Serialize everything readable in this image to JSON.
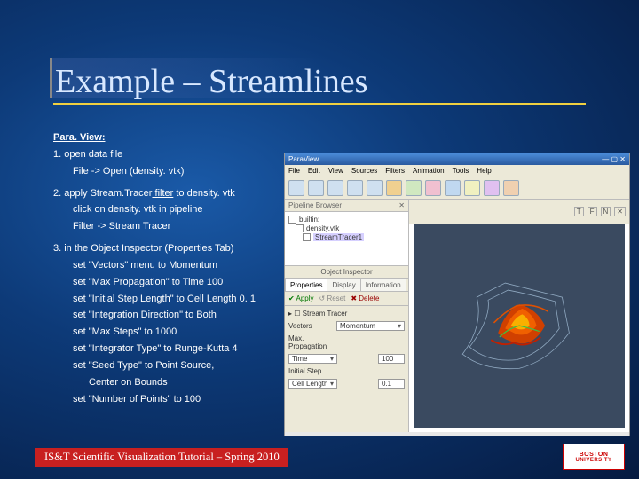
{
  "slide": {
    "title": "Example – Streamlines"
  },
  "instructions": {
    "heading": "Para. View:",
    "step1": "1. open data file",
    "step1a": "File -> Open (density. vtk)",
    "step2_pre": "2. apply Stream.Tracer",
    "step2_mid": " filter",
    "step2_post": " to density. vtk",
    "step2a": "click on density. vtk in pipeline",
    "step2b": "Filter -> Stream Tracer",
    "step3": "3. in the Object Inspector (Properties Tab)",
    "step3a": "set \"Vectors\" menu to Momentum",
    "step3b": "set \"Max Propagation\" to Time 100",
    "step3c": "set \"Initial Step Length\" to Cell Length 0. 1",
    "step3d": "set \"Integration Direction\" to Both",
    "step3e": "set \"Max Steps\" to 1000",
    "step3f": "set \"Integrator Type\" to Runge-Kutta 4",
    "step3g": "set \"Seed Type\" to Point Source,",
    "step3h": "Center on Bounds",
    "step3i": "set \"Number of Points\" to 100"
  },
  "paraview": {
    "window_title": "ParaView",
    "menu": {
      "file": "File",
      "edit": "Edit",
      "view": "View",
      "sources": "Sources",
      "filters": "Filters",
      "animation": "Animation",
      "tools": "Tools",
      "help": "Help"
    },
    "pipeline": {
      "header": "Pipeline Browser",
      "item0": "builtin:",
      "item1": "density.vtk",
      "item2": "StreamTracer1"
    },
    "inspector": {
      "header": "Object Inspector",
      "tab_prop": "Properties",
      "tab_disp": "Display",
      "tab_info": "Information",
      "apply": "Apply",
      "reset": "Reset",
      "delete": "Delete",
      "stream_tracer": "Stream Tracer",
      "vectors_lbl": "Vectors",
      "vectors_val": "Momentum",
      "maxprop_lbl": "Max. Propagation",
      "maxprop_sel": "Time",
      "maxprop_val": "100",
      "initstep_lbl": "Initial Step",
      "initstep_sel": "Cell Length",
      "initstep_val": "0.1"
    },
    "render_head": {
      "t": "T",
      "f": "F",
      "n": "N"
    }
  },
  "footer": "IS&T Scientific Visualization Tutorial – Spring 2010",
  "logo": {
    "line1": "BOSTON",
    "line2": "UNIVERSITY"
  }
}
